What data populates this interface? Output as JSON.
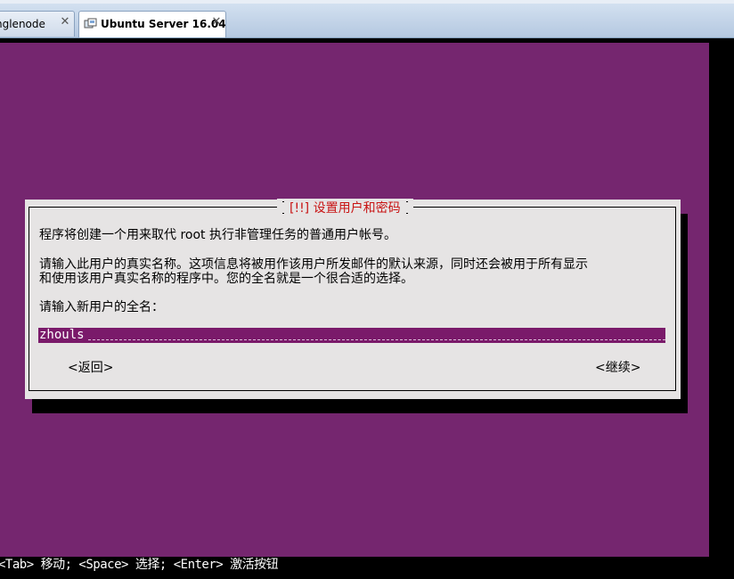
{
  "tabs": [
    {
      "label": "nglenode",
      "close": "✕"
    },
    {
      "label": "Ubuntu Server 16.04",
      "close": "✕"
    }
  ],
  "dialog": {
    "title": "[!!] 设置用户和密码",
    "intro": "程序将创建一个用来取代 root 执行非管理任务的普通用户帐号。",
    "description_line1": "请输入此用户的真实名称。这项信息将被用作该用户所发邮件的默认来源，同时还会被用于所有显示",
    "description_line2": "和使用该用户真实名称的程序中。您的全名就是一个很合适的选择。",
    "prompt": "请输入新用户的全名：",
    "full_name_value": "zhouls",
    "back_label": "<返回>",
    "continue_label": "<继续>"
  },
  "help_line": "<Tab> 移动; <Space> 选择; <Enter> 激活按钮",
  "colors": {
    "console_background": "#75266f",
    "dialog_background": "#e6e4e4",
    "title_color": "#c81414",
    "input_background": "#7a1a6a"
  }
}
